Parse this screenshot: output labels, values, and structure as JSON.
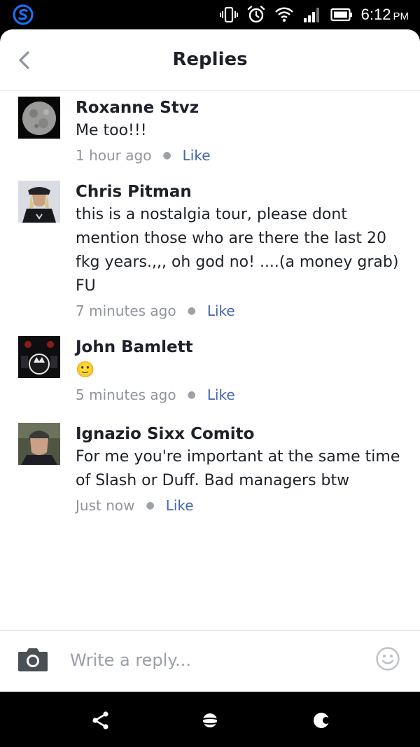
{
  "status_bar": {
    "time": "6:12",
    "ampm": "PM",
    "icons": [
      "vibrate-icon",
      "alarm-icon",
      "wifi-icon",
      "signal-icon",
      "battery-icon"
    ]
  },
  "header": {
    "title": "Replies",
    "back_icon": "chevron-left-icon"
  },
  "comments": [
    {
      "name": "Roxanne Stvz",
      "text": "Me too!!!",
      "time": "1 hour ago",
      "like_label": "Like",
      "avatar": "moon-photo"
    },
    {
      "name": "Chris Pitman",
      "text": "this is a nostalgia tour,  please dont mention those who are there the last 20 fkg years.,,,  oh god no!    ....(a money grab) FU",
      "time": "7 minutes ago",
      "like_label": "Like",
      "avatar": "person-in-cap-photo"
    },
    {
      "name": "John Bamlett",
      "text": "🙂",
      "time": "5 minutes ago",
      "like_label": "Like",
      "avatar": "drum-kit-photo"
    },
    {
      "name": "Ignazio Sixx Comito",
      "text": "For me you're important at the same time of Slash or Duff. Bad managers btw",
      "time": "Just now",
      "like_label": "Like",
      "avatar": "man-portrait-photo"
    }
  ],
  "composer": {
    "placeholder": "Write a reply...",
    "camera_icon": "camera-icon",
    "emoji_icon": "smiley-icon"
  },
  "nav_bar": {
    "icons": [
      "share-icon",
      "planet-icon",
      "moon-icon"
    ]
  },
  "colors": {
    "accent_like": "#4267b2",
    "text_primary": "#1d2129",
    "text_secondary": "#90949c",
    "status_bar_bg": "#000000",
    "app_icon": "#1a73ff"
  }
}
